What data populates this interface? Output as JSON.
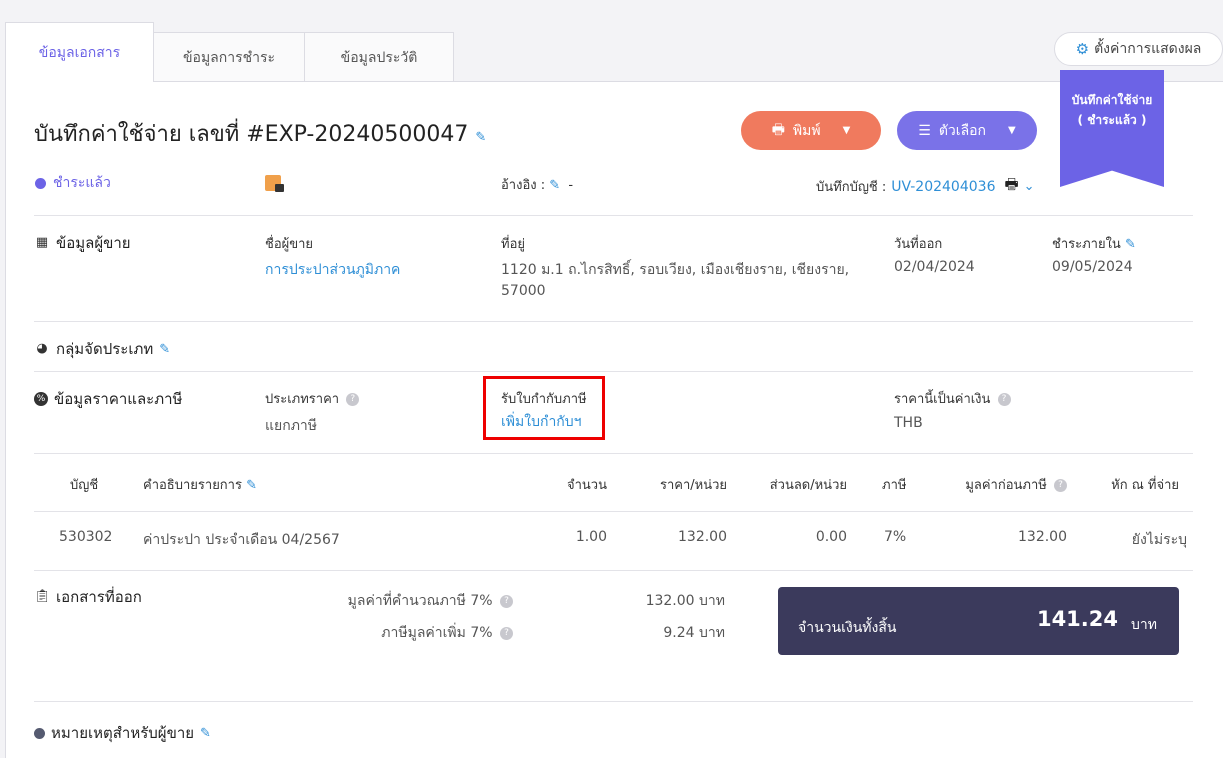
{
  "tabs": [
    {
      "label": "ข้อมูลเอกสาร"
    },
    {
      "label": "ข้อมูลการชำระ"
    },
    {
      "label": "ข้อมูลประวัติ"
    }
  ],
  "settings_label": "ตั้งค่าการแสดงผล",
  "ribbon": {
    "line1": "บันทึกค่าใช้จ่าย",
    "line2": "( ชำระแล้ว )"
  },
  "title": "บันทึกค่าใช้จ่าย เลขที่ #EXP-20240500047",
  "buttons": {
    "print": "พิมพ์",
    "options": "ตัวเลือก"
  },
  "status": {
    "label": "ชำระแล้ว",
    "color": "#6c63e6"
  },
  "reference": {
    "label": "อ้างอิง :",
    "value": "-"
  },
  "journal": {
    "label": "บันทึกบัญชี :",
    "value": "UV-202404036"
  },
  "vendor": {
    "section": "ข้อมูลผู้ขาย",
    "name_label": "ชื่อผู้ขาย",
    "name": "การประปาส่วนภูมิภาค",
    "address_label": "ที่อยู่",
    "address_line1": "1120 ม.1 ถ.ไกรสิทธิ์, รอบเวียง, เมืองเชียงราย, เชียงราย,",
    "address_line2": "57000",
    "issue_date_label": "วันที่ออก",
    "issue_date": "02/04/2024",
    "due_label": "ชำระภายใน",
    "due_date": "09/05/2024"
  },
  "category_section": "กลุ่มจัดประเภท",
  "pricing": {
    "section": "ข้อมูลราคาและภาษี",
    "price_type_label": "ประเภทราคา",
    "price_type": "แยกภาษี",
    "tax_invoice_label": "รับใบกำกับภาษี",
    "tax_invoice_link": "เพิ่มใบกำกับฯ",
    "currency_label": "ราคานี้เป็นค่าเงิน",
    "currency": "THB"
  },
  "table": {
    "headers": {
      "account": "บัญชี",
      "description": "คำอธิบายรายการ",
      "qty": "จำนวน",
      "unit_price": "ราคา/หน่วย",
      "discount": "ส่วนลด/หน่วย",
      "tax": "ภาษี",
      "pre_tax": "มูลค่าก่อนภาษี",
      "withholding": "หัก ณ ที่จ่าย"
    },
    "rows": [
      {
        "account": "530302",
        "description": "ค่าประปา ประจำเดือน 04/2567",
        "qty": "1.00",
        "unit_price": "132.00",
        "discount": "0.00",
        "tax": "7%",
        "pre_tax": "132.00",
        "withholding": "ยังไม่ระบุ"
      }
    ]
  },
  "documents_section": "เอกสารที่ออก",
  "summary": {
    "taxable_label": "มูลค่าที่คำนวณภาษี 7%",
    "taxable_value": "132.00 บาท",
    "vat_label": "ภาษีมูลค่าเพิ่ม 7%",
    "vat_value": "9.24 บาท",
    "total_label": "จำนวนเงินทั้งสิ้น",
    "total_value": "141.24",
    "total_unit": "บาท"
  },
  "notes_section": "หมายเหตุสำหรับผู้ขาย"
}
